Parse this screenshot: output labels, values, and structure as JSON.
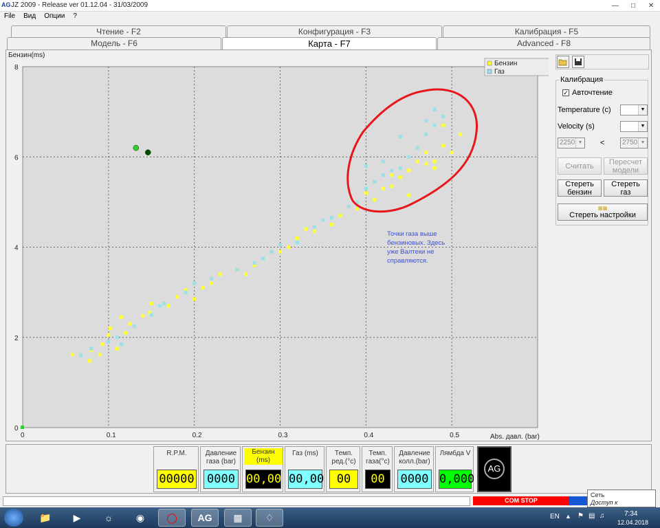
{
  "window": {
    "title": "JZ 2009 - Release ver 01.12.04 - 31/03/2009",
    "app_icon": "AG"
  },
  "menu": [
    "File",
    "Вид",
    "Опции",
    "?"
  ],
  "tabs_row1": [
    "Чтение - F2",
    "Конфигурация - F3",
    "Калибрация - F5"
  ],
  "tabs_row2": [
    "Модель - F6",
    "Карта - F7",
    "Advanced - F8"
  ],
  "active_tab": "Карта - F7",
  "chart_data": {
    "type": "scatter",
    "ylabel": "Бензин(ms)",
    "xlabel": "Abs. давл. (bar)",
    "xlim": [
      0,
      0.6
    ],
    "ylim": [
      0,
      8
    ],
    "xticks": [
      "0",
      "0.1",
      "0.2",
      "0.3",
      "0.4",
      "0.5"
    ],
    "yticks": [
      "0",
      "2",
      "4",
      "6",
      "8"
    ],
    "grid": true,
    "legend_position": "top-right",
    "series": [
      {
        "name": "Бензин",
        "color": "#ffff33",
        "points": [
          [
            0.058,
            1.62
          ],
          [
            0.078,
            1.48
          ],
          [
            0.08,
            1.72
          ],
          [
            0.09,
            1.62
          ],
          [
            0.093,
            1.85
          ],
          [
            0.1,
            2.05
          ],
          [
            0.102,
            2.2
          ],
          [
            0.11,
            1.75
          ],
          [
            0.115,
            2.45
          ],
          [
            0.12,
            2.1
          ],
          [
            0.125,
            2.3
          ],
          [
            0.14,
            2.48
          ],
          [
            0.148,
            2.55
          ],
          [
            0.15,
            2.75
          ],
          [
            0.17,
            2.7
          ],
          [
            0.18,
            2.9
          ],
          [
            0.19,
            3.05
          ],
          [
            0.2,
            2.85
          ],
          [
            0.21,
            3.1
          ],
          [
            0.22,
            3.2
          ],
          [
            0.23,
            3.4
          ],
          [
            0.25,
            3.5
          ],
          [
            0.26,
            3.4
          ],
          [
            0.27,
            3.6
          ],
          [
            0.3,
            3.9
          ],
          [
            0.31,
            4.0
          ],
          [
            0.32,
            4.2
          ],
          [
            0.33,
            4.4
          ],
          [
            0.34,
            4.35
          ],
          [
            0.36,
            4.5
          ],
          [
            0.37,
            4.7
          ],
          [
            0.38,
            4.9
          ],
          [
            0.39,
            4.85
          ],
          [
            0.4,
            5.2
          ],
          [
            0.41,
            5.05
          ],
          [
            0.42,
            5.3
          ],
          [
            0.43,
            5.6
          ],
          [
            0.44,
            5.55
          ],
          [
            0.45,
            5.7
          ],
          [
            0.46,
            5.9
          ],
          [
            0.47,
            5.85
          ],
          [
            0.48,
            5.9
          ],
          [
            0.49,
            6.25
          ],
          [
            0.5,
            6.1
          ],
          [
            0.51,
            6.5
          ],
          [
            0.43,
            5.35
          ],
          [
            0.45,
            5.15
          ],
          [
            0.47,
            6.1
          ],
          [
            0.48,
            5.75
          ],
          [
            0.49,
            6.7
          ]
        ]
      },
      {
        "name": "Газ",
        "color": "#99e0e8",
        "points": [
          [
            0.068,
            1.6
          ],
          [
            0.08,
            1.75
          ],
          [
            0.1,
            1.9
          ],
          [
            0.11,
            2.0
          ],
          [
            0.115,
            1.85
          ],
          [
            0.13,
            2.25
          ],
          [
            0.15,
            2.5
          ],
          [
            0.16,
            2.7
          ],
          [
            0.165,
            2.75
          ],
          [
            0.19,
            3.0
          ],
          [
            0.2,
            3.2
          ],
          [
            0.22,
            3.3
          ],
          [
            0.25,
            3.5
          ],
          [
            0.27,
            3.65
          ],
          [
            0.28,
            3.75
          ],
          [
            0.29,
            3.9
          ],
          [
            0.3,
            4.05
          ],
          [
            0.32,
            4.1
          ],
          [
            0.34,
            4.45
          ],
          [
            0.35,
            4.6
          ],
          [
            0.36,
            4.65
          ],
          [
            0.38,
            4.9
          ],
          [
            0.39,
            5.0
          ],
          [
            0.4,
            5.3
          ],
          [
            0.41,
            5.45
          ],
          [
            0.42,
            5.6
          ],
          [
            0.43,
            5.7
          ],
          [
            0.44,
            5.75
          ],
          [
            0.45,
            6.0
          ],
          [
            0.46,
            6.2
          ],
          [
            0.47,
            6.5
          ],
          [
            0.48,
            6.7
          ],
          [
            0.48,
            7.05
          ],
          [
            0.47,
            6.8
          ],
          [
            0.44,
            6.45
          ],
          [
            0.42,
            5.9
          ],
          [
            0.4,
            5.8
          ],
          [
            0.49,
            6.9
          ]
        ]
      }
    ],
    "extra_markers": [
      {
        "x": 0.132,
        "y": 6.2,
        "color": "#33cc33"
      },
      {
        "x": 0.146,
        "y": 6.1,
        "color": "#004d00"
      }
    ],
    "annotation_text": "Точки газа выше бензиновых. Здесь уже Валтеки не справляются."
  },
  "annotation_lines": [
    "Точки газа выше",
    "бензиновых. Здесь",
    "уже Валтеки не",
    "справляются."
  ],
  "annotation_color": "#3b4fd8",
  "calib": {
    "group_title": "Калибрация",
    "auto_read_label": "Авточтение",
    "auto_read_checked": "✓",
    "temperature_label": "Temperature (c)",
    "velocity_label": "Velocity (s)",
    "rpm_low": "2250",
    "rpm_sep": "<",
    "rpm_high": "2750",
    "btn_read": "Считать",
    "btn_recalc_1": "Пересчет",
    "btn_recalc_2": "модели",
    "btn_erase_petrol_1": "Стереть",
    "btn_erase_petrol_2": "бензин",
    "btn_erase_gas_1": "Стереть",
    "btn_erase_gas_2": "газ",
    "btn_erase_settings": "Стереть настройки"
  },
  "gauges": [
    {
      "label": "R.P.M.",
      "value": "00000",
      "bg": "#ffff00"
    },
    {
      "label": "Давление газа (bar)",
      "value": "0000",
      "bg": "#80ffff"
    },
    {
      "label": "Бензин (ms)",
      "value": "00,00",
      "bg": "#000000"
    },
    {
      "label": "Газ (ms)",
      "value": "00,00",
      "bg": "#80ffff"
    },
    {
      "label": "Темп. ред.(°c)",
      "value": "00",
      "bg": "#ffff00"
    },
    {
      "label": "Темп. газа(°c)",
      "value": "00",
      "bg": "#000000"
    },
    {
      "label": "Давление колл.(bar)",
      "value": "0000",
      "bg": "#80ffff"
    },
    {
      "label": "Лямбда V",
      "value": "0,000",
      "bg": "#00ff00"
    }
  ],
  "logo": "AG",
  "status": {
    "com_stop": "COM STOP",
    "tooltip_line1": "Сеть",
    "tooltip_line2": "Доступ к Интернету"
  },
  "taskbar": {
    "lang": "EN",
    "time": "7:34",
    "date": "12.04.2018"
  }
}
